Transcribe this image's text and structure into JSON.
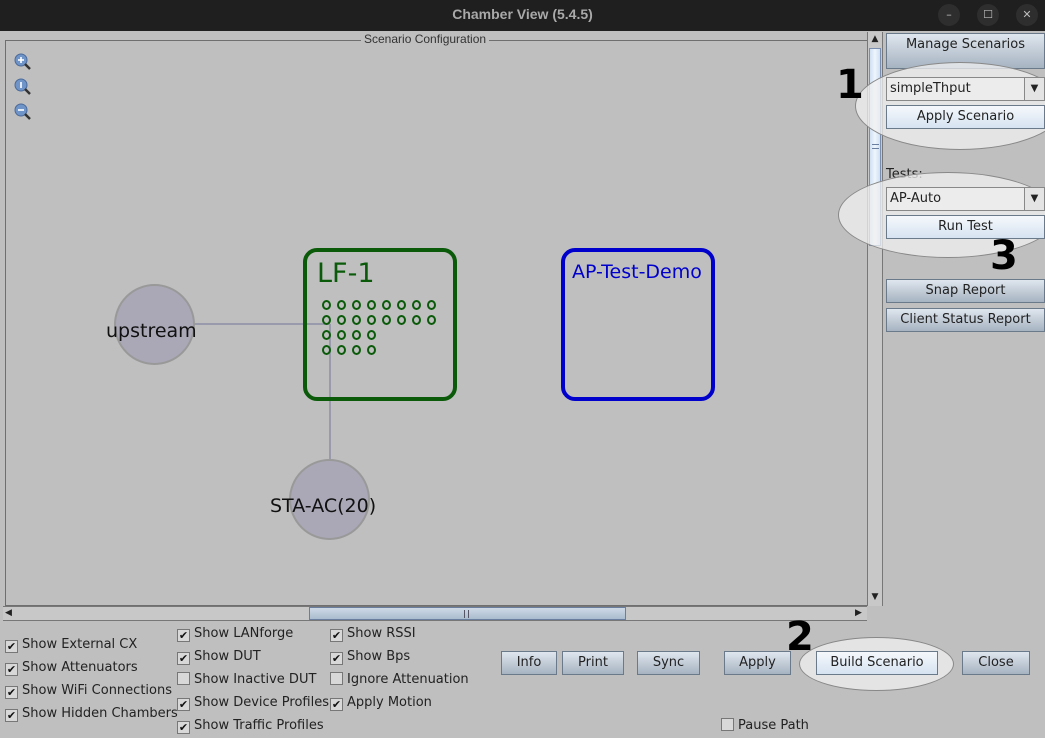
{
  "window": {
    "title": "Chamber View (5.4.5)",
    "controls": [
      "minimize",
      "maximize",
      "close"
    ]
  },
  "scenario_panel": {
    "title": "Scenario Configuration",
    "zoom_icons": [
      "zoom-in-icon",
      "zoom-reset-icon",
      "zoom-out-icon"
    ],
    "nodes": [
      {
        "label": "upstream",
        "type": "connection"
      },
      {
        "label": "STA-AC(20)",
        "type": "connection"
      }
    ],
    "chambers": [
      {
        "label": "LF-1",
        "color": "#0a5a0a",
        "port_count": 24,
        "port_rows": [
          8,
          8,
          4,
          4
        ]
      },
      {
        "label": "AP-Test-Demo",
        "color": "#0000cc"
      }
    ]
  },
  "sidebar": {
    "manage_scenarios": "Manage Scenarios",
    "scenario_select": "simpleThput",
    "apply_scenario": "Apply Scenario",
    "tests_label": "Tests:",
    "tests_select": "AP-Auto",
    "run_test": "Run Test",
    "snap_report": "Snap Report",
    "client_status_report": "Client Status Report"
  },
  "annotations": {
    "one": "1",
    "two": "2",
    "three": "3"
  },
  "checkboxes": {
    "col1": [
      {
        "label": "Show External CX",
        "checked": true
      },
      {
        "label": "Show Attenuators",
        "checked": true
      },
      {
        "label": "Show WiFi Connections",
        "checked": true
      },
      {
        "label": "Show Hidden Chambers",
        "checked": true
      }
    ],
    "col2": [
      {
        "label": "Show LANforge",
        "checked": true
      },
      {
        "label": "Show DUT",
        "checked": true
      },
      {
        "label": "Show Inactive DUT",
        "checked": false
      },
      {
        "label": "Show Device Profiles",
        "checked": true
      },
      {
        "label": "Show Traffic Profiles",
        "checked": true
      }
    ],
    "col3": [
      {
        "label": "Show RSSI",
        "checked": true
      },
      {
        "label": "Show Bps",
        "checked": true
      },
      {
        "label": "Ignore Attenuation",
        "checked": false
      },
      {
        "label": "Apply Motion",
        "checked": true
      }
    ],
    "pause_path": {
      "label": "Pause Path",
      "checked": false
    }
  },
  "buttons": {
    "info": "Info",
    "print": "Print",
    "sync": "Sync",
    "apply": "Apply",
    "build_scenario": "Build Scenario",
    "close": "Close"
  }
}
